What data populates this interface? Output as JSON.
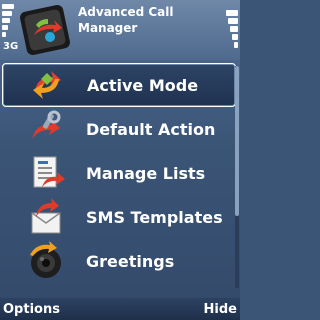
{
  "status": {
    "network": "3G"
  },
  "app": {
    "title": "Advanced Call Manager",
    "icon": "call-manager-app-icon"
  },
  "menu": {
    "items": [
      {
        "label": "Active Mode",
        "icon": "active-mode-icon",
        "selected": true
      },
      {
        "label": "Default Action",
        "icon": "default-action-icon",
        "selected": false
      },
      {
        "label": "Manage Lists",
        "icon": "manage-lists-icon",
        "selected": false
      },
      {
        "label": "SMS Templates",
        "icon": "sms-templates-icon",
        "selected": false
      },
      {
        "label": "Greetings",
        "icon": "greetings-icon",
        "selected": false
      }
    ]
  },
  "softkeys": {
    "left": "Options",
    "right": "Hide"
  },
  "colors": {
    "background": "#3b5577",
    "selection": "#1f3150",
    "text": "#ffffff"
  }
}
